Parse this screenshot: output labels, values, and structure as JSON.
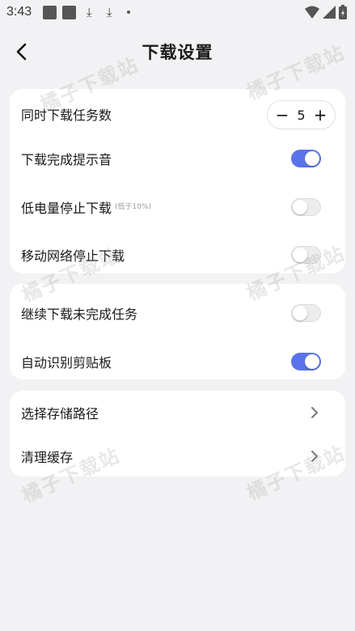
{
  "status_bar": {
    "time": "3:43"
  },
  "header": {
    "title": "下载设置"
  },
  "settings": {
    "concurrent": {
      "label": "同时下载任务数",
      "value": "5",
      "minus": "−",
      "plus": "+"
    },
    "sound": {
      "label": "下载完成提示音",
      "state": "on"
    },
    "low_battery": {
      "label": "低电量停止下载",
      "note": "(低于10%)",
      "state": "off"
    },
    "mobile_network": {
      "label": "移动网络停止下载",
      "state": "off"
    },
    "resume": {
      "label": "继续下载未完成任务",
      "state": "off"
    },
    "clipboard": {
      "label": "自动识别剪贴板",
      "state": "on"
    },
    "storage_path": {
      "label": "选择存储路径"
    },
    "clear_cache": {
      "label": "清理缓存"
    }
  },
  "watermark": {
    "text": "橘子下载站"
  },
  "colors": {
    "accent": "#5b73e8",
    "background": "#f2f2f4",
    "card": "#ffffff"
  }
}
